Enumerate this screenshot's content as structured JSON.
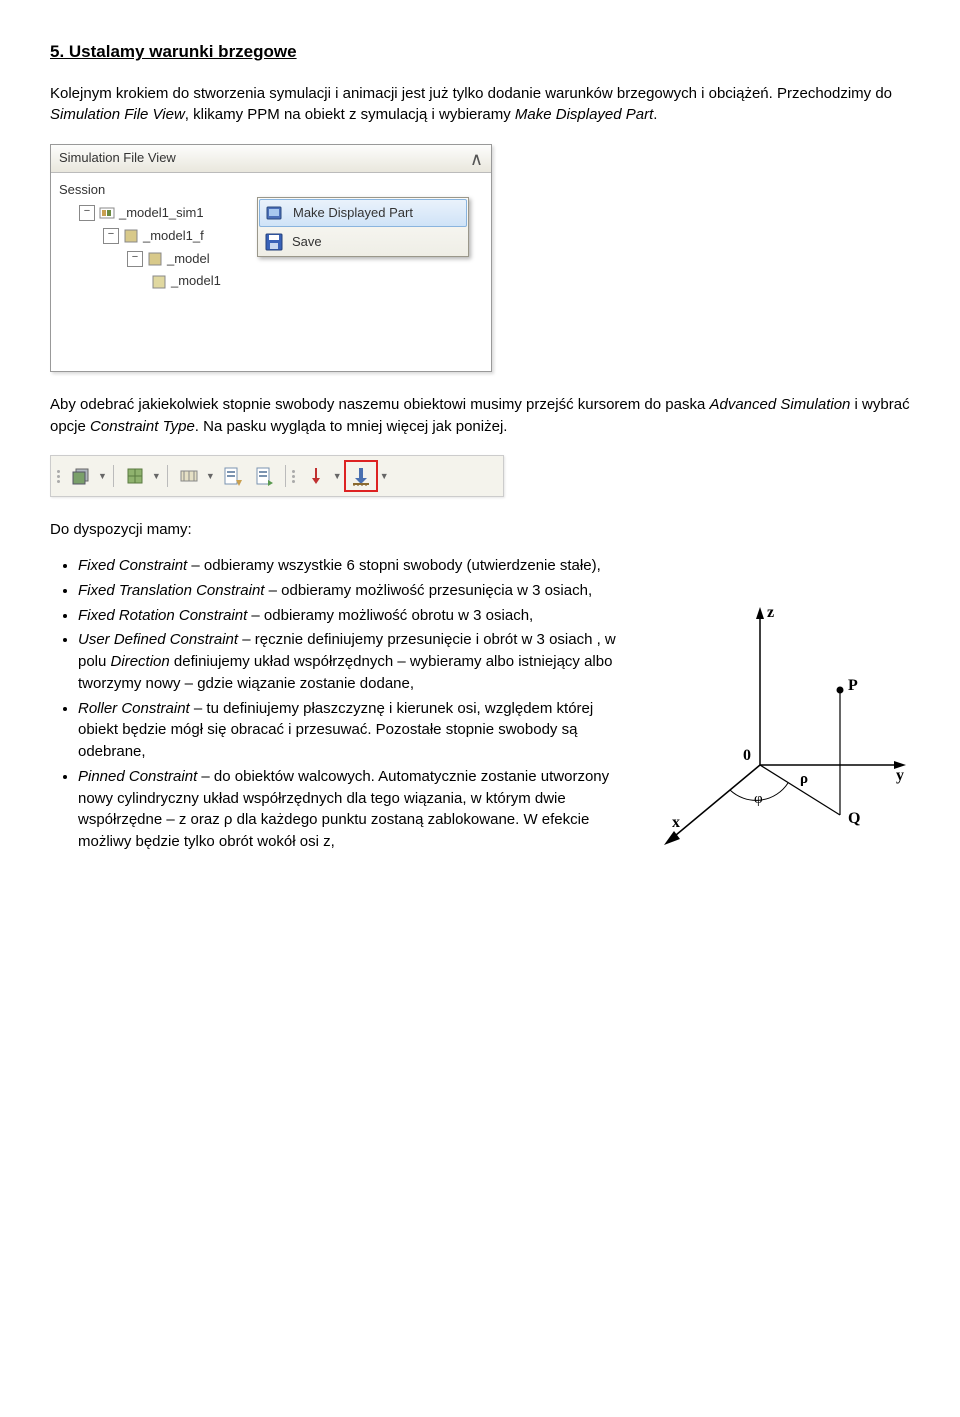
{
  "heading": "5. Ustalamy warunki brzegowe",
  "para1_a": "Kolejnym krokiem do stworzenia symulacji i animacji jest już tylko dodanie warunków brzegowych i obciążeń. Przechodzimy do ",
  "para1_i1": "Simulation File View",
  "para1_b": ", klikamy PPM na obiekt z symulacją i wybieramy ",
  "para1_i2": "Make Displayed Part",
  "para1_c": ".",
  "panel": {
    "title": "Simulation File View",
    "session": "Session",
    "n1": "_model1_sim1",
    "n2": "_model1_f",
    "n3": "_model",
    "n4": "_model1"
  },
  "ctx": {
    "make": "Make Displayed Part",
    "save": "Save"
  },
  "para2_a": "Aby odebrać jakiekolwiek stopnie swobody naszemu obiektowi musimy przejść kursorem do paska ",
  "para2_i1": "Advanced Simulation",
  "para2_b": " i wybrać opcje ",
  "para2_i2": "Constraint Type",
  "para2_c": ". Na pasku wygląda to mniej więcej jak poniżej.",
  "para3": "Do dyspozycji mamy:",
  "list": {
    "i0_i": "Fixed Constraint",
    "i0_t": " – odbieramy wszystkie 6 stopni swobody (utwierdzenie stałe),",
    "i1_i": "Fixed Translation Constraint",
    "i1_t": " – odbieramy możliwość przesunięcia w 3 osiach,",
    "i2_i": "Fixed Rotation Constraint",
    "i2_t": " – odbieramy możliwość obrotu w 3 osiach,",
    "i3_i": "User Defined Constraint",
    "i3_t1": " – ręcznie definiujemy przesunięcie i obrót w 3 osiach , w polu ",
    "i3_i2": "Direction",
    "i3_t2": " definiujemy układ współrzędnych – wybieramy albo istniejący albo tworzymy nowy – gdzie wiązanie zostanie dodane,",
    "i4_i": "Roller Constraint",
    "i4_t": " – tu definiujemy płaszczyznę i kierunek osi, względem której obiekt będzie mógł się obracać i przesuwać. Pozostałe stopnie swobody są odebrane,",
    "i5_i": "Pinned Constraint",
    "i5_t": " – do obiektów walcowych. Automatycznie zostanie utworzony nowy cylindryczny układ współrzędnych dla tego wiązania, w którym dwie współrzędne – z oraz ρ dla każdego punktu zostaną zablokowane. W efekcie możliwy będzie tylko obrót wokół osi z,"
  },
  "coord": {
    "x": "x",
    "y": "y",
    "z": "z",
    "o": "0",
    "p": "P",
    "q": "Q",
    "phi": "φ",
    "rho": "ρ"
  }
}
